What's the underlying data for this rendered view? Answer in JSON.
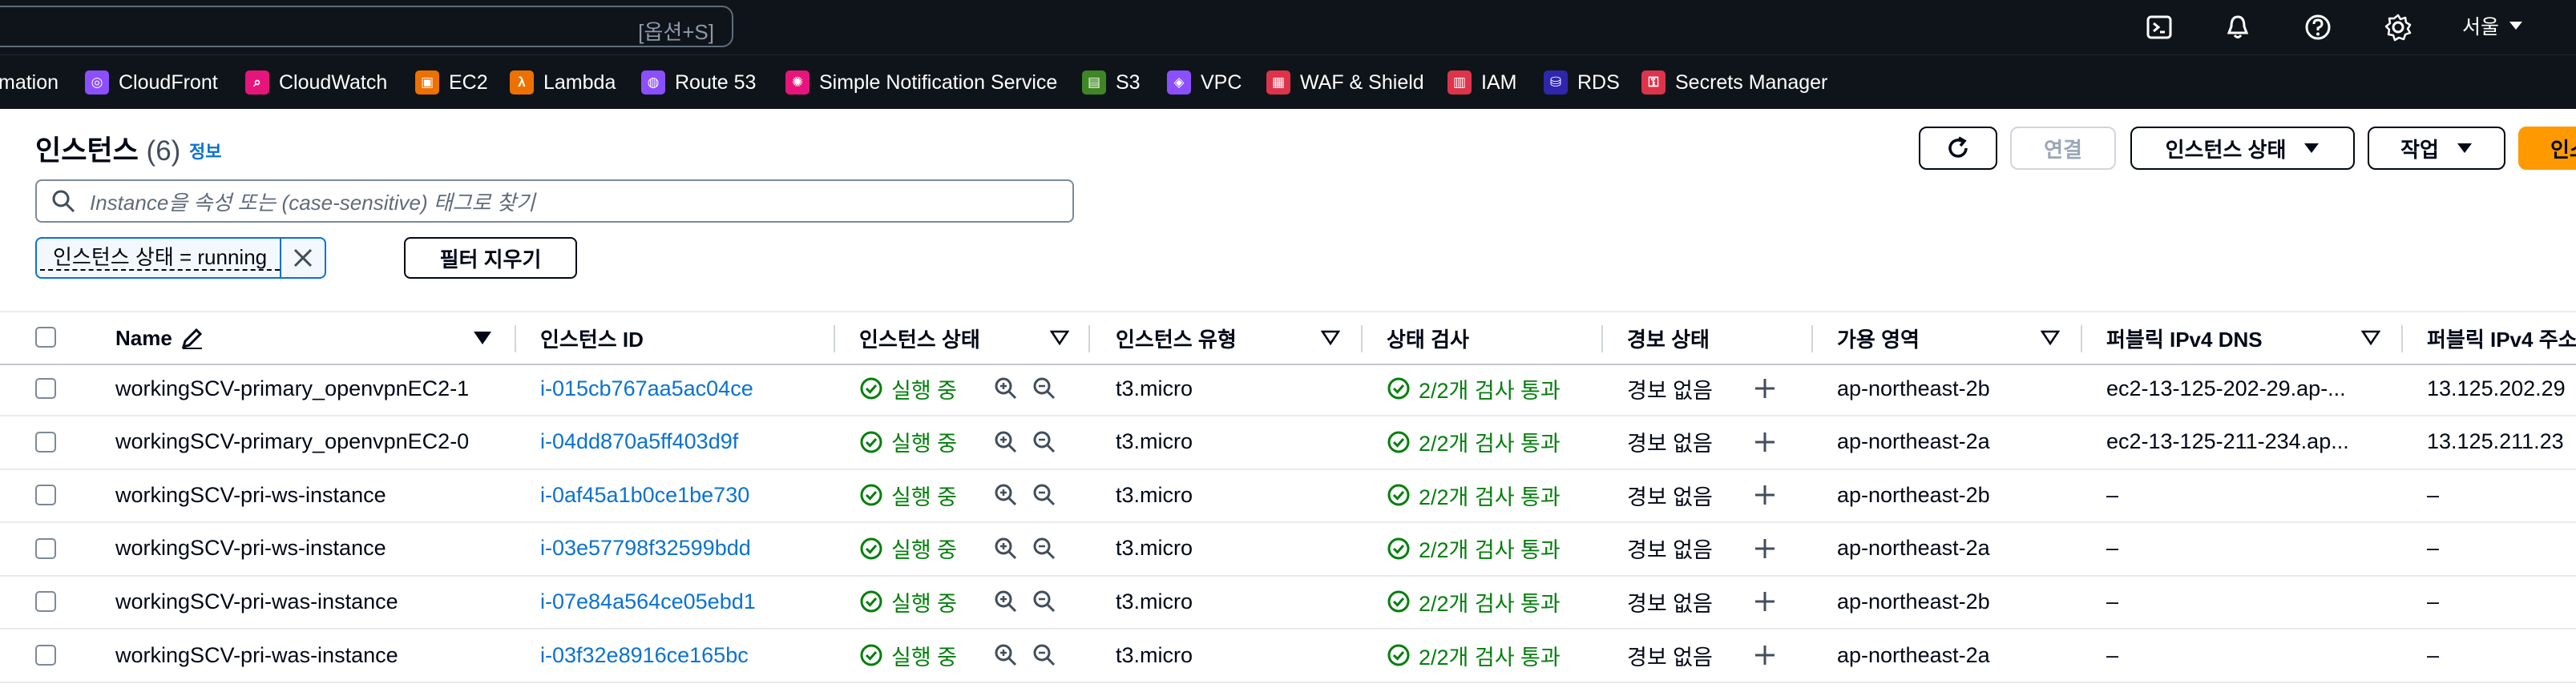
{
  "topbar": {
    "search_shortcut": "[옵션+S]",
    "region": "서울",
    "icons": [
      "cloudshell-icon",
      "bell-icon",
      "help-icon",
      "gear-icon"
    ]
  },
  "favorites": [
    {
      "label": "mation",
      "icon": "",
      "color": ""
    },
    {
      "label": "CloudFront",
      "icon": "cloudfront-icon",
      "color": "#8c4fff"
    },
    {
      "label": "CloudWatch",
      "icon": "cloudwatch-icon",
      "color": "#e7157b"
    },
    {
      "label": "EC2",
      "icon": "ec2-icon",
      "color": "#ed7100"
    },
    {
      "label": "Lambda",
      "icon": "lambda-icon",
      "color": "#ed7100"
    },
    {
      "label": "Route 53",
      "icon": "route53-icon",
      "color": "#8c4fff"
    },
    {
      "label": "Simple Notification Service",
      "icon": "sns-icon",
      "color": "#e7157b"
    },
    {
      "label": "S3",
      "icon": "s3-icon",
      "color": "#3f8624"
    },
    {
      "label": "VPC",
      "icon": "vpc-icon",
      "color": "#8c4fff"
    },
    {
      "label": "WAF & Shield",
      "icon": "waf-icon",
      "color": "#dd344c"
    },
    {
      "label": "IAM",
      "icon": "iam-icon",
      "color": "#dd344c"
    },
    {
      "label": "RDS",
      "icon": "rds-icon",
      "color": "#2e27ad"
    },
    {
      "label": "Secrets Manager",
      "icon": "secrets-manager-icon",
      "color": "#dd344c"
    }
  ],
  "page": {
    "title": "인스턴스",
    "count": "(6)",
    "info": "정보"
  },
  "actions": {
    "connect": "연결",
    "instance_state": "인스턴스 상태",
    "actions": "작업",
    "launch": "인스"
  },
  "filter": {
    "placeholder": "Instance을 속성 또는 (case-sensitive) 태그로 찾기",
    "token": "인스턴스 상태 = running",
    "clear": "필터 지우기"
  },
  "columns": {
    "name": "Name",
    "instance_id": "인스턴스 ID",
    "state": "인스턴스 상태",
    "type": "인스턴스 유형",
    "status_check": "상태 검사",
    "alarm": "경보 상태",
    "az": "가용 영역",
    "public_dns": "퍼블릭 IPv4 DNS",
    "public_ip": "퍼블릭 IPv4 주소"
  },
  "rows": [
    {
      "name": "workingSCV-primary_openvpnEC2-1",
      "id": "i-015cb767aa5ac04ce",
      "state": "실행 중",
      "type": "t3.micro",
      "check": "2/2개 검사 통과",
      "alarm": "경보 없음",
      "az": "ap-northeast-2b",
      "dns": "ec2-13-125-202-29.ap-...",
      "ip": "13.125.202.29"
    },
    {
      "name": "workingSCV-primary_openvpnEC2-0",
      "id": "i-04dd870a5ff403d9f",
      "state": "실행 중",
      "type": "t3.micro",
      "check": "2/2개 검사 통과",
      "alarm": "경보 없음",
      "az": "ap-northeast-2a",
      "dns": "ec2-13-125-211-234.ap...",
      "ip": "13.125.211.23"
    },
    {
      "name": "workingSCV-pri-ws-instance",
      "id": "i-0af45a1b0ce1be730",
      "state": "실행 중",
      "type": "t3.micro",
      "check": "2/2개 검사 통과",
      "alarm": "경보 없음",
      "az": "ap-northeast-2b",
      "dns": "–",
      "ip": "–"
    },
    {
      "name": "workingSCV-pri-ws-instance",
      "id": "i-03e57798f32599bdd",
      "state": "실행 중",
      "type": "t3.micro",
      "check": "2/2개 검사 통과",
      "alarm": "경보 없음",
      "az": "ap-northeast-2a",
      "dns": "–",
      "ip": "–"
    },
    {
      "name": "workingSCV-pri-was-instance",
      "id": "i-07e84a564ce05ebd1",
      "state": "실행 중",
      "type": "t3.micro",
      "check": "2/2개 검사 통과",
      "alarm": "경보 없음",
      "az": "ap-northeast-2b",
      "dns": "–",
      "ip": "–"
    },
    {
      "name": "workingSCV-pri-was-instance",
      "id": "i-03f32e8916ce165bc",
      "state": "실행 중",
      "type": "t3.micro",
      "check": "2/2개 검사 통과",
      "alarm": "경보 없음",
      "az": "ap-northeast-2a",
      "dns": "–",
      "ip": "–"
    }
  ],
  "colors": {
    "nav_bg": "#0f141a",
    "link": "#0972d3",
    "success": "#037f0c",
    "primary": "#ff9900"
  }
}
